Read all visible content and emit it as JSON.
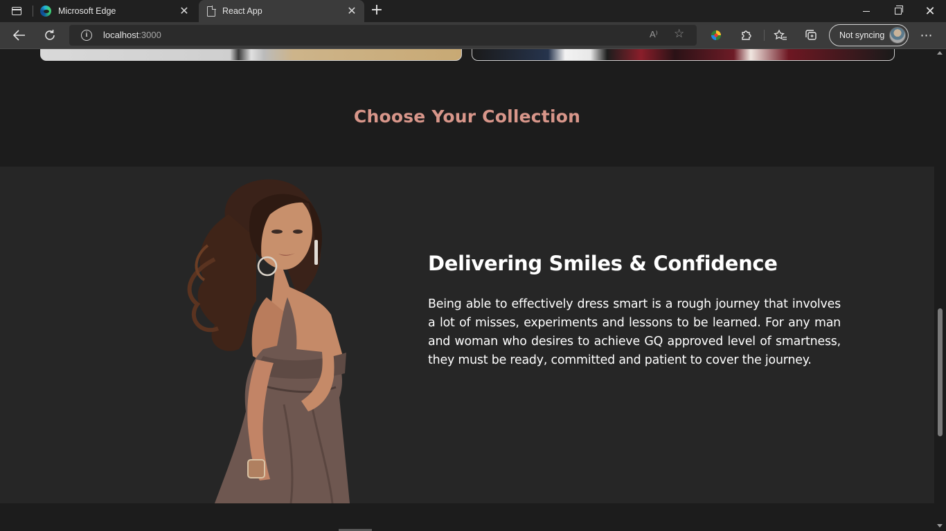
{
  "browser": {
    "tabs": [
      {
        "title": "Microsoft Edge",
        "active": false,
        "icon": "edge-logo-icon"
      },
      {
        "title": "React App",
        "active": true,
        "icon": "page-icon"
      }
    ],
    "new_tab_label": "+",
    "url_host": "localhost",
    "url_port": ":3000",
    "read_aloud_label": "A⁾",
    "sync_label": "Not syncing"
  },
  "page": {
    "collection_heading": "Choose Your Collection",
    "feature": {
      "title": "Delivering Smiles & Confidence",
      "body": "Being able to effectively dress smart is a rough journey that involves a lot of misses, experiments and lessons to be learned. For any man and woman who desires to achieve GQ approved level of smartness, they must be ready, committed and patient to cover the journey."
    }
  },
  "colors": {
    "heading_accent": "#d8968a",
    "page_bg": "#1c1c1c",
    "feature_bg": "#262626",
    "dress": "#6e5750",
    "hair": "#3a2219",
    "skin": "#c58a68"
  }
}
